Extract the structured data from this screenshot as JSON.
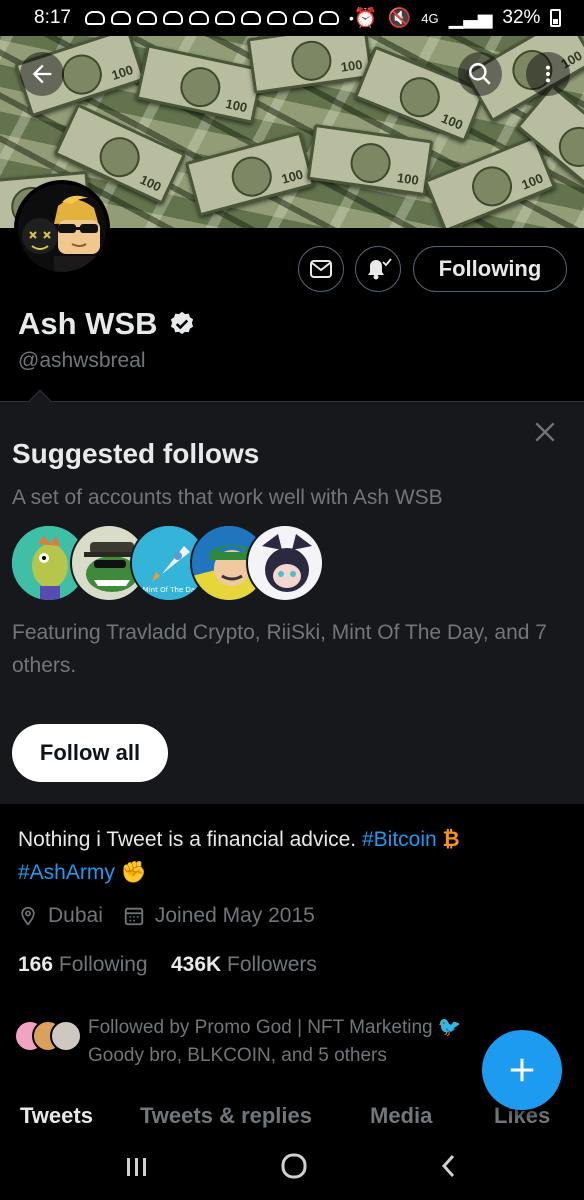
{
  "statusbar": {
    "time": "8:17",
    "network": "4G",
    "battery": "32%"
  },
  "profile": {
    "name": "Ash WSB",
    "handle": "@ashwsbreal",
    "following_label": "Following",
    "bio_text": "Nothing i Tweet is a financial advice.",
    "bio_hashtag1": "#Bitcoin",
    "bio_hashtag2": "#AshArmy",
    "location": "Dubai",
    "joined": "Joined May 2015",
    "following_count": "166",
    "following_text": "Following",
    "followers_count": "436K",
    "followers_text": "Followers",
    "followed_by_line1": "Followed by Promo God | NFT Marketing",
    "followed_by_line2": "Goody bro, BLKCOIN, and 5 others"
  },
  "suggested": {
    "title": "Suggested follows",
    "subtitle": "A set of accounts that work well with Ash WSB",
    "featuring": "Featuring Travladd Crypto, RiiSki, Mint Of The Day, and 7 others.",
    "follow_all": "Follow all",
    "mint_label": "Mint Of The Day"
  },
  "tabs": [
    "Tweets",
    "Tweets & replies",
    "Media",
    "Likes"
  ],
  "colors": {
    "accent": "#1d9bf0",
    "background": "#000000",
    "panel": "#16181c",
    "muted": "#71767b"
  }
}
